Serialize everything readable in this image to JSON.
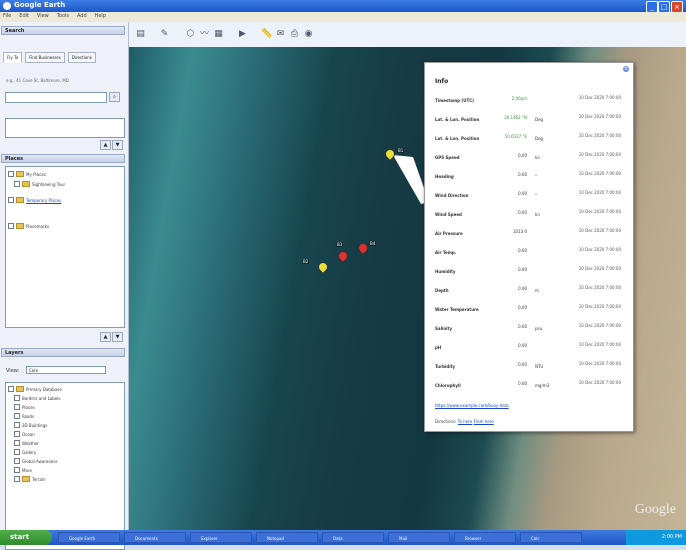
{
  "window": {
    "title": "Google Earth"
  },
  "menu": [
    "File",
    "Edit",
    "View",
    "Tools",
    "Add",
    "Help"
  ],
  "search": {
    "header": "Search",
    "tabs": [
      "Fly To",
      "Find Businesses",
      "Directions"
    ],
    "hint": "e.g., 41 Cove St, Baltimore, MD"
  },
  "places": {
    "header": "Places",
    "items": [
      "My Places",
      "Sightseeing Tour",
      "Temporary Places",
      "Placemarks"
    ]
  },
  "layers": {
    "header": "Layers",
    "view_label": "View:",
    "view_value": "Core",
    "items": [
      "Primary Database",
      "Borders and Labels",
      "Places",
      "Roads",
      "3D Buildings",
      "Ocean",
      "Weather",
      "Gallery",
      "Global Awareness",
      "More",
      "Terrain"
    ]
  },
  "balloon": {
    "title": "Info",
    "rows": [
      {
        "name": "Timestamp (UTC)",
        "value": "2:00pm",
        "unit": "",
        "date": "10 Dec 2020 7:00:00",
        "green": true
      },
      {
        "name": "Lat. & Lon. Position",
        "value": "26.1462 °N",
        "unit": "Deg",
        "date": "10 Dec 2020 7:00:00",
        "green": true
      },
      {
        "name": "Lat. & Lon. Position",
        "value": "50.6327 °E",
        "unit": "Deg",
        "date": "10 Dec 2020 7:00:00",
        "green": true
      },
      {
        "name": "GPS Speed",
        "value": "0.00",
        "unit": "kn",
        "date": "10 Dec 2020 7:00:00",
        "green": false
      },
      {
        "name": "Heading",
        "value": "0.00",
        "unit": "°",
        "date": "10 Dec 2020 7:00:00",
        "green": false
      },
      {
        "name": "Wind Direction",
        "value": "0.00",
        "unit": "°",
        "date": "10 Dec 2020 7:00:00",
        "green": false
      },
      {
        "name": "Wind Speed",
        "value": "0.00",
        "unit": "kn",
        "date": "10 Dec 2020 7:00:00",
        "green": false
      },
      {
        "name": "Air Pressure",
        "value": "1013.0",
        "unit": "",
        "date": "10 Dec 2020 7:00:00",
        "green": false
      },
      {
        "name": "Air Temp.",
        "value": "0.00",
        "unit": "",
        "date": "10 Dec 2020 7:00:00",
        "green": false
      },
      {
        "name": "Humidity",
        "value": "0.00",
        "unit": "",
        "date": "10 Dec 2020 7:00:00",
        "green": false
      },
      {
        "name": "Depth",
        "value": "0.00",
        "unit": "m",
        "date": "10 Dec 2020 7:00:00",
        "green": false
      },
      {
        "name": "Water Temperature",
        "value": "0.00",
        "unit": "",
        "date": "10 Dec 2020 7:00:00",
        "green": false
      },
      {
        "name": "Salinity",
        "value": "0.00",
        "unit": "psu",
        "date": "10 Dec 2020 7:00:00",
        "green": false
      },
      {
        "name": "pH",
        "value": "0.00",
        "unit": "",
        "date": "10 Dec 2020 7:00:00",
        "green": false
      },
      {
        "name": "Turbidity",
        "value": "0.00",
        "unit": "NTU",
        "date": "10 Dec 2020 7:00:00",
        "green": false
      },
      {
        "name": "Chlorophyll",
        "value": "0.00",
        "unit": "mg/m3",
        "date": "10 Dec 2020 7:00:00",
        "green": false
      }
    ],
    "link": "https://www.example.com/buoy-data",
    "footer_prefix": "Directions:",
    "footer_to": "To here",
    "footer_from": "From here"
  },
  "pins": [
    {
      "label": "B1",
      "color": "#e8e03a"
    },
    {
      "label": "B2",
      "color": "#e8e03a"
    },
    {
      "label": "B3",
      "color": "#e23030"
    },
    {
      "label": "B4",
      "color": "#e23030"
    }
  ],
  "watermark": "Google",
  "taskbar": {
    "start": "start",
    "buttons": [
      "Google Earth",
      "Documents",
      "Explorer",
      "Notepad",
      "Data",
      "Mail",
      "Browser",
      "Calc"
    ],
    "time": "2:00 PM"
  }
}
